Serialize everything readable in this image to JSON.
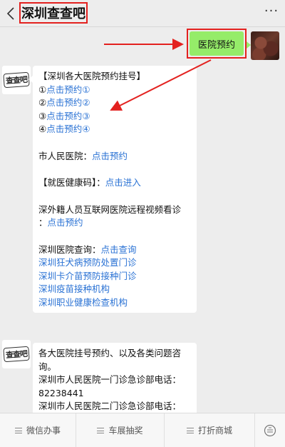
{
  "header": {
    "back_icon": "back-arrow-icon",
    "title": "深圳查查吧",
    "more_label": "···"
  },
  "user_message": {
    "text": "医院预约"
  },
  "bot_avatar_label": "查查吧",
  "bot_messages": [
    {
      "lines": [
        {
          "text": "【深圳各大医院预约挂号】"
        },
        {
          "prefix": "①",
          "link": "点击预约①"
        },
        {
          "prefix": "②",
          "link": "点击预约②"
        },
        {
          "prefix": "③",
          "link": "点击预约③"
        },
        {
          "prefix": "④",
          "link": "点击预约④"
        },
        {
          "gap": true
        },
        {
          "prefix": "市人民医院：",
          "link": "点击预约"
        },
        {
          "gap": true
        },
        {
          "prefix": "【就医健康码】：",
          "link": "点击进入"
        },
        {
          "gap": true
        },
        {
          "text": "深外籍人员互联网医院远程视频看诊"
        },
        {
          "prefix": "：",
          "link": "点击预约"
        },
        {
          "gap": true
        },
        {
          "prefix": "深圳医院查询：",
          "link": "点击查询"
        },
        {
          "link": "深圳狂犬病预防处置门诊"
        },
        {
          "link": "深圳卡介苗预防接种门诊"
        },
        {
          "link": "深圳疫苗接种机构"
        },
        {
          "link": "深圳职业健康检查机构"
        }
      ]
    },
    {
      "lines": [
        {
          "text": "各大医院挂号预约、以及各类问题咨"
        },
        {
          "text": "询。"
        },
        {
          "text": "深圳市人民医院一门诊急诊部电话："
        },
        {
          "text": "82238441"
        },
        {
          "text": "深圳市人民医院二门诊急诊部电话："
        }
      ]
    }
  ],
  "bottom_menu": [
    {
      "label": "微信办事"
    },
    {
      "label": "车展抽奖"
    },
    {
      "label": "打折商城"
    }
  ],
  "colors": {
    "link": "#2a72d4",
    "user_bubble": "#95ec69",
    "highlight_border": "#e3211f",
    "background": "#ededed"
  }
}
